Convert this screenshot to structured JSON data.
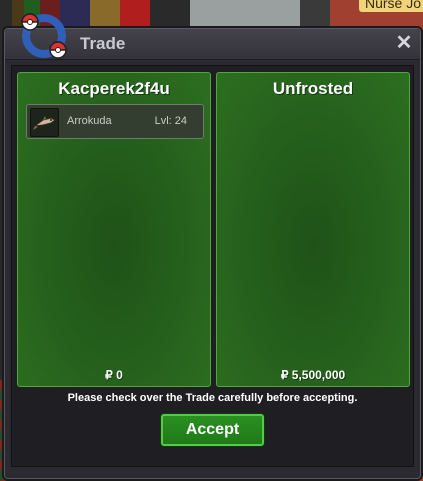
{
  "hud": {
    "npc_label": "Nurse Jo"
  },
  "window": {
    "title": "Trade",
    "close_label": "✕"
  },
  "players": [
    {
      "name": "Kacperek2f4u",
      "money": "₽ 0",
      "items": [
        {
          "name": "Arrokuda",
          "level": "Lvl: 24",
          "icon": "arrokuda-sprite"
        }
      ]
    },
    {
      "name": "Unfrosted",
      "money": "₽ 5,500,000",
      "items": []
    }
  ],
  "footer": {
    "note": "Please check over the Trade carefully before accepting.",
    "accept_label": "Accept"
  },
  "colors": {
    "panel_green": "#27631d",
    "panel_border": "#4ea83b",
    "window_bg": "#2b2a31",
    "accept_green": "#2a8f22"
  }
}
